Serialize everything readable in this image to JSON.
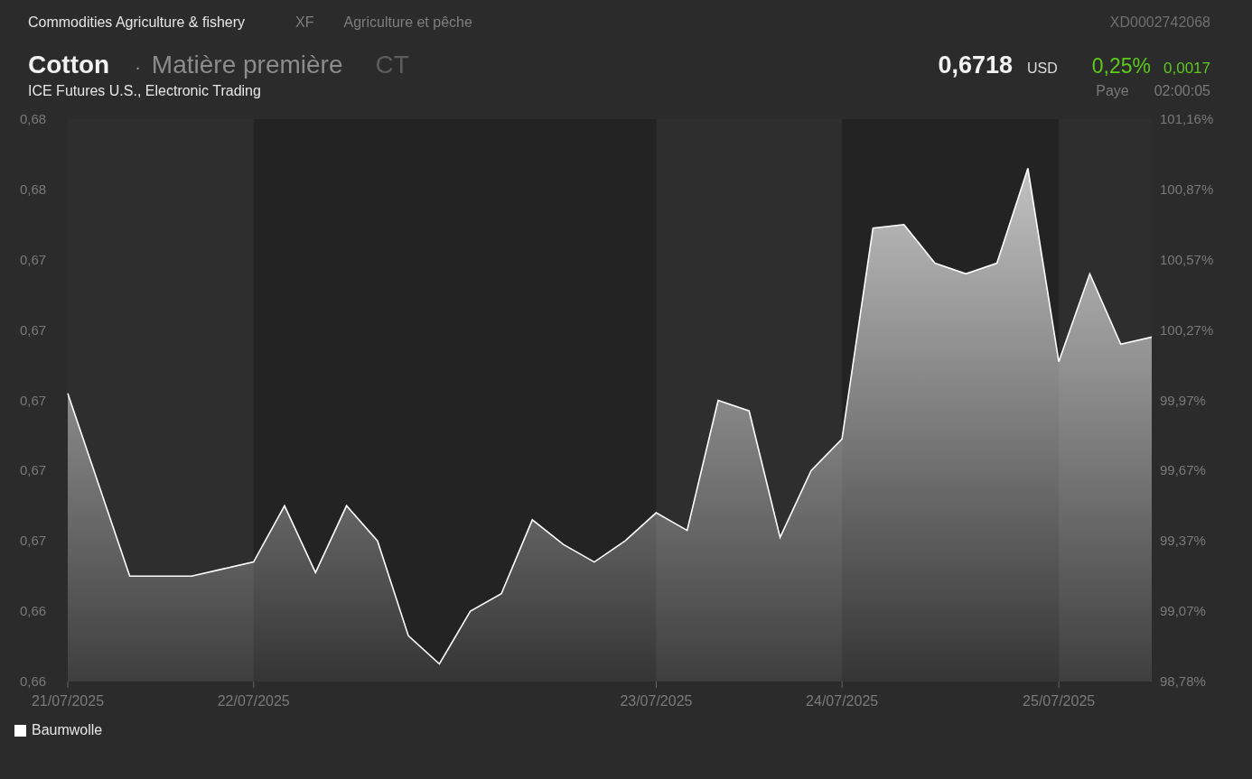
{
  "header": {
    "category": "Commodities Agriculture & fishery",
    "exchange_code": "XF",
    "category_local": "Agriculture et pêche",
    "isin": "XD0002742068"
  },
  "instrument": {
    "name": "Cotton",
    "separator": "·",
    "type": "Matière première",
    "symbol": "CT",
    "market": "ICE Futures U.S., Electronic Trading"
  },
  "quote": {
    "price": "0,6718",
    "currency": "USD",
    "change_percent": "0,25%",
    "change": "0,0017",
    "status": "Paye",
    "time": "02:00:05"
  },
  "chart": {
    "right_axis_labels": [
      "101,16%",
      "100,87%",
      "100,57%",
      "100,27%",
      "99,97%",
      "99,67%",
      "99,37%",
      "99,07%",
      "98,78%"
    ],
    "chart_data": {
      "type": "area",
      "categories": [
        "21/07/2025",
        null,
        null,
        null,
        null,
        null,
        "22/07/2025",
        null,
        null,
        null,
        null,
        null,
        null,
        null,
        null,
        null,
        null,
        null,
        null,
        "23/07/2025",
        null,
        null,
        null,
        null,
        null,
        "24/07/2025",
        null,
        null,
        null,
        null,
        null,
        null,
        "25/07/2025",
        null,
        null,
        null
      ],
      "series": [
        {
          "name": "Baumwolle",
          "color": "#ffffff",
          "values": [
            0.6701,
            0.6675,
            0.6649,
            0.6649,
            0.6649,
            0.6651,
            0.6653,
            0.6669,
            0.665,
            0.6669,
            0.6659,
            0.6632,
            0.6624,
            0.6639,
            0.6644,
            0.6665,
            0.6658,
            0.6653,
            0.6659,
            0.6667,
            0.6662,
            0.6699,
            0.6696,
            0.666,
            0.6679,
            0.6688,
            0.6748,
            0.6749,
            0.6738,
            0.6735,
            0.6738,
            0.6765,
            0.671,
            0.6735,
            0.6715,
            0.6717
          ]
        }
      ],
      "ylim": [
        0.6619,
        0.6779
      ],
      "yticks": [
        {
          "value": 0.6619,
          "label": "0,66"
        },
        {
          "value": 0.6639,
          "label": "0,66"
        },
        {
          "value": 0.6659,
          "label": "0,67"
        },
        {
          "value": 0.6679,
          "label": "0,67"
        },
        {
          "value": 0.6699,
          "label": "0,67"
        },
        {
          "value": 0.6719,
          "label": "0,67"
        },
        {
          "value": 0.6739,
          "label": "0,67"
        },
        {
          "value": 0.6759,
          "label": "0,68"
        },
        {
          "value": 0.6779,
          "label": "0,68"
        }
      ]
    }
  }
}
